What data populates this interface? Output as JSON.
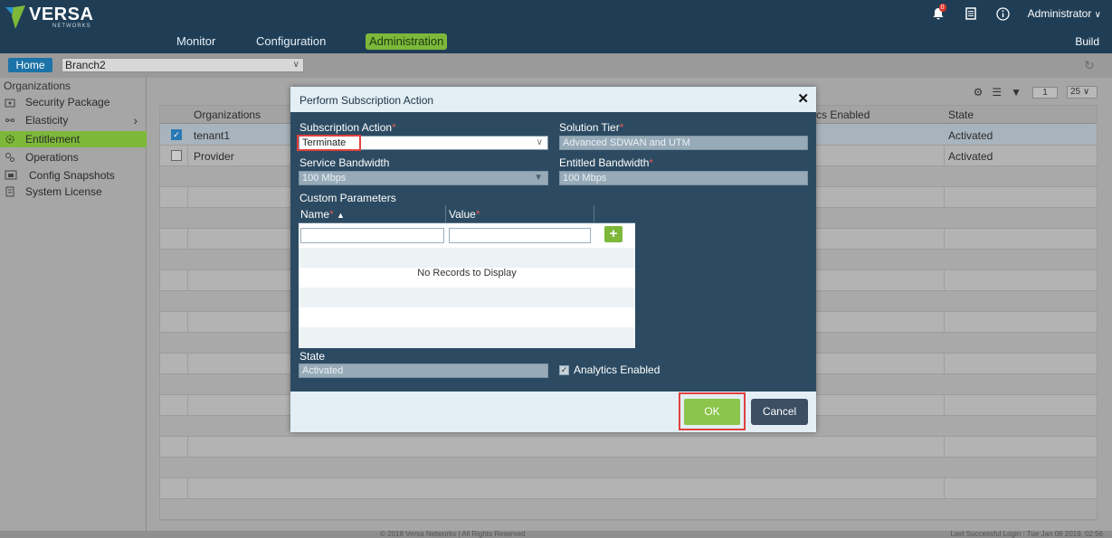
{
  "colors": {
    "topbar": "#1f3e56",
    "accent_green": "#7db83a",
    "modal_body": "#2c4b62",
    "modal_header": "#e3eef5",
    "highlight_red": "#e0403f",
    "home_blue": "#1c73a8"
  },
  "app": {
    "logo_text": "VERSA",
    "logo_subtext": "NETWORKS",
    "notification_count": "0",
    "user_menu": "Administrator",
    "build_label": "Build"
  },
  "nav": {
    "tabs": [
      {
        "label": "Monitor"
      },
      {
        "label": "Configuration"
      },
      {
        "label": "Administration",
        "active": true
      }
    ]
  },
  "subbar": {
    "home_label": "Home",
    "appliance": "Branch2"
  },
  "sidebar": {
    "title": "Organizations",
    "items": [
      {
        "label": "Security Package",
        "icon": "package-icon"
      },
      {
        "label": "Elasticity",
        "icon": "elasticity-icon",
        "has_submenu": true
      },
      {
        "label": "Entitlement",
        "icon": "gear-icon",
        "active": true
      },
      {
        "label": "Operations",
        "icon": "gears-icon"
      },
      {
        "label": "Config Snapshots",
        "icon": "snapshot-icon"
      },
      {
        "label": "System License",
        "icon": "license-icon"
      }
    ]
  },
  "grid": {
    "columns": [
      "Organizations",
      "ytics Enabled",
      "State"
    ],
    "rows": [
      {
        "organization": "tenant1",
        "state": "Activated",
        "checked": true
      },
      {
        "organization": "Provider",
        "state": "Activated",
        "checked": false
      }
    ],
    "page_number": "1",
    "page_size": "25"
  },
  "modal": {
    "title": "Perform Subscription Action",
    "subscription_action_label": "Subscription Action",
    "subscription_action_value": "Terminate",
    "solution_tier_label": "Solution Tier",
    "solution_tier_value": "Advanced SDWAN and UTM",
    "service_bandwidth_label": "Service Bandwidth",
    "service_bandwidth_value": "100 Mbps",
    "entitled_bandwidth_label": "Entitled Bandwidth",
    "entitled_bandwidth_value": "100 Mbps",
    "custom_parameters_label": "Custom Parameters",
    "custom_name_header": "Name",
    "custom_value_header": "Value",
    "add_button": "+",
    "empty_message": "No Records to Display",
    "state_label": "State",
    "state_value": "Activated",
    "analytics_label": "Analytics Enabled",
    "analytics_checked": true,
    "ok_label": "OK",
    "cancel_label": "Cancel",
    "required_marker": "*"
  },
  "footer": {
    "copyright": "© 2018 Versa Networks | All Rights Reserved",
    "last_login": "Last Successful Login : Tue Jan 08 2019, 02:56"
  }
}
